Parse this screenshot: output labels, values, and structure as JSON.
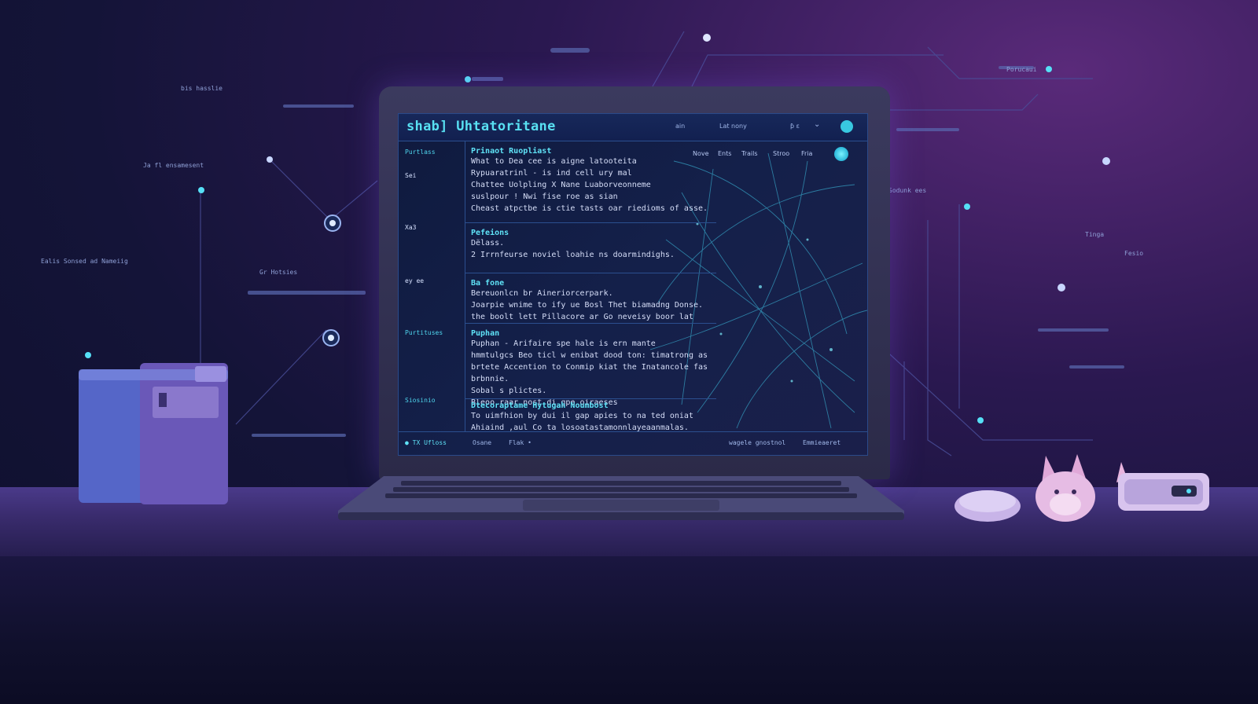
{
  "app": {
    "title": "shab] Uhtatoritane",
    "titlebar_labels": [
      "ain",
      "Lat nony",
      "ƥ ɛ",
      "⌄"
    ]
  },
  "sidebar": {
    "items": [
      "Purtlass",
      "Sei",
      "Xa3",
      "ey ee",
      "Purtituses",
      "Siosinio"
    ]
  },
  "toolbar": {
    "buttons": [
      "Nove",
      "Ents",
      "Trails",
      "Stroo",
      "Fria"
    ]
  },
  "entries": [
    {
      "head": "Prinaot Ruopliast",
      "lines": [
        "What to Dea cee is aigne latooteita",
        "Rypuaratrinl - is ind cell ury mal",
        "Chattee Uolpling X Nane Luaborveonneme",
        "suslpour ! Nwi fise roe as sian",
        "Cheast atpctbe is ctie tasts oar riedioms of asse."
      ]
    },
    {
      "head": "Pefeions",
      "lines": [
        "Dëlass.",
        "2 Irrnfeurse noviel loahie ns doarmindighs."
      ]
    },
    {
      "head": "Ba fone",
      "lines": [
        "Bereuonlcn br Aineriorcerpark.",
        "Joarpie  wnime to ify ue Bosl Thet biamadng Donse.",
        "the boolt lett Pillacore ar Go neveisy boor lat"
      ]
    },
    {
      "head": "Puphan",
      "lines": [
        "Puphan - Arifaire spe hale is ern mante",
        "hmmtulgcs Beo ticl w enibat dood ton: timatrong as",
        "brtete Accention to Conmip kiat the Inatancole fas",
        "brbnnie.",
        "Sobal s plictes.",
        "Bleoo raar nost di gpe oiraeses"
      ]
    },
    {
      "head": "Dtecoraptame Hytugah Noumbost",
      "lines": [
        "To uimfhion by dui il gap apies to na ted oniat",
        "Ahiaind ,aul Co ta losoatastamonnlayeaanmalas."
      ]
    }
  ],
  "statusbar": {
    "left": "● TX  Ufloss",
    "mid": [
      "Osane",
      "Flak •"
    ],
    "right": [
      "wagele gnostnol",
      "Emmieaeret"
    ]
  },
  "floating_labels": [
    "Ja fl ensamesent",
    "Ealis Sonsed ad Nameiig",
    "Gr Hotsies",
    "bis hasslie",
    "Sodunk ees",
    "Porucaui",
    "Fesio",
    "Tinga"
  ],
  "colors": {
    "accent_cyan": "#5fe2f6",
    "screen_bg": "#121d44",
    "bg_purple": "#5a2a7a",
    "bg_navy": "#141438"
  }
}
